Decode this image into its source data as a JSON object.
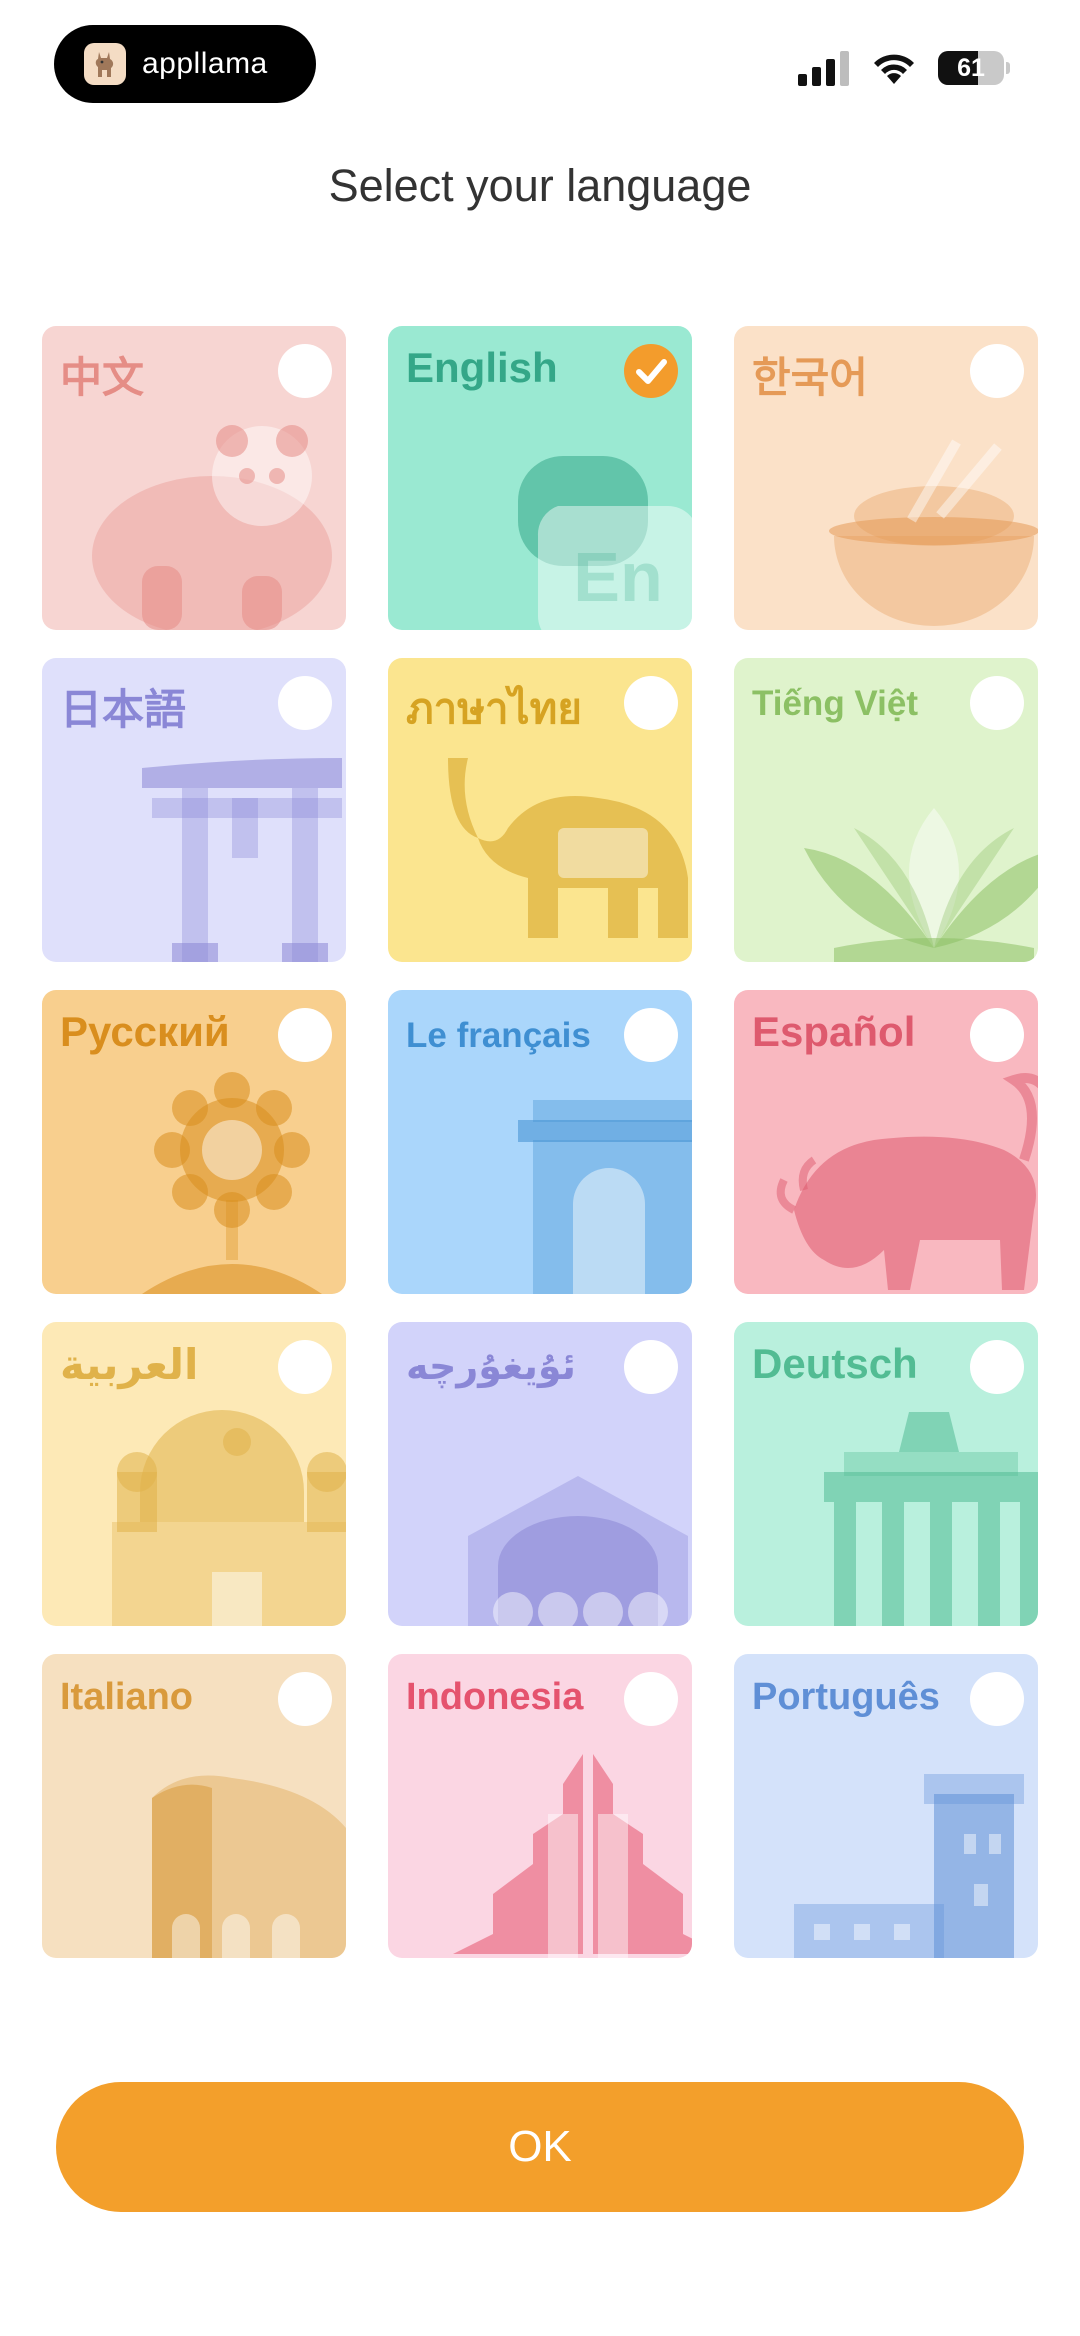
{
  "status_bar": {
    "brand_name": "appllama",
    "battery_level": "61",
    "battery_fraction": 0.61
  },
  "title": "Select your language",
  "languages": [
    {
      "label": "中文",
      "checked": false,
      "bg": "#f7d5d2",
      "fg": "#e58d86",
      "illus": "panda-icon"
    },
    {
      "label": "English",
      "checked": true,
      "bg": "#9ae9d2",
      "fg": "#34a788",
      "illus": "en-speech-bubble-icon"
    },
    {
      "label": "한국어",
      "checked": false,
      "bg": "#fbe1c8",
      "fg": "#e59a57",
      "illus": "rice-bowl-icon"
    },
    {
      "label": "日本語",
      "checked": false,
      "bg": "#dfe0fb",
      "fg": "#8a87d6",
      "illus": "torii-gate-icon"
    },
    {
      "label": "ภาษาไทย",
      "checked": false,
      "bg": "#fbe58f",
      "fg": "#d6a322",
      "illus": "elephant-icon"
    },
    {
      "label": "Tiếng Việt",
      "checked": false,
      "bg": "#dff3cc",
      "fg": "#8cc064",
      "illus": "lotus-icon"
    },
    {
      "label": "Русский",
      "checked": false,
      "bg": "#f8cf8e",
      "fg": "#d98e1e",
      "illus": "sunflower-icon"
    },
    {
      "label": "Le français",
      "checked": false,
      "bg": "#aad6fb",
      "fg": "#3f8fd2",
      "illus": "arc-de-triomphe-icon"
    },
    {
      "label": "Español",
      "checked": false,
      "bg": "#f9b8c0",
      "fg": "#de5a6e",
      "illus": "bull-icon"
    },
    {
      "label": "العربية",
      "checked": false,
      "bg": "#fde9b6",
      "fg": "#e0b24a",
      "illus": "mosque-icon"
    },
    {
      "label": "ئۇيغۇرچە",
      "checked": false,
      "bg": "#d2d3fa",
      "fg": "#8a87d6",
      "illus": "domed-building-icon"
    },
    {
      "label": "Deutsch",
      "checked": false,
      "bg": "#b9f0dd",
      "fg": "#52bc93",
      "illus": "brandenburg-gate-icon"
    },
    {
      "label": "Italiano",
      "checked": false,
      "bg": "#f6e0c0",
      "fg": "#d99a3c",
      "illus": "colosseum-icon"
    },
    {
      "label": "Indonesia",
      "checked": false,
      "bg": "#fbd6e3",
      "fg": "#e5536e",
      "illus": "split-gate-icon"
    },
    {
      "label": "Português",
      "checked": false,
      "bg": "#d4e2fa",
      "fg": "#5f8fd6",
      "illus": "belem-tower-icon"
    }
  ],
  "ok_label": "OK",
  "colors": {
    "accent": "#f39f2b",
    "title_text": "#333333"
  }
}
